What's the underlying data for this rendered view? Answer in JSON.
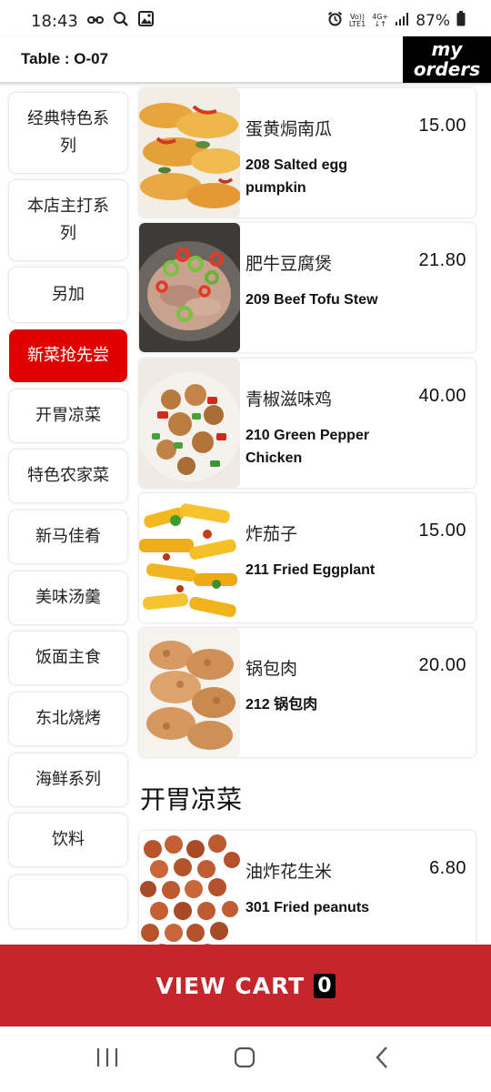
{
  "status": {
    "time": "18:43",
    "battery": "87%",
    "lte_top": "Vo))",
    "lte_bottom": "LTE1",
    "net_top": "4G+",
    "net_bottom": "↓↑"
  },
  "header": {
    "table": "Table : O-07",
    "my_orders_line1": "my",
    "my_orders_line2": "orders"
  },
  "sidebar": {
    "categories": [
      {
        "label": "经典特色系列",
        "active": false
      },
      {
        "label": "本店主打系列",
        "active": false
      },
      {
        "label": "另加",
        "active": false
      },
      {
        "label": "新菜抢先尝",
        "active": true
      },
      {
        "label": "开胃凉菜",
        "active": false
      },
      {
        "label": "特色农家菜",
        "active": false
      },
      {
        "label": "新马佳肴",
        "active": false
      },
      {
        "label": "美味汤羹",
        "active": false
      },
      {
        "label": "饭面主食",
        "active": false
      },
      {
        "label": "东北烧烤",
        "active": false
      },
      {
        "label": "海鲜系列",
        "active": false
      },
      {
        "label": "饮料",
        "active": false
      }
    ]
  },
  "menu": {
    "items": [
      {
        "cn": "蛋黄焗南瓜",
        "en": "208 Salted egg pumpkin",
        "price": "15.00",
        "image": "salted-egg-pumpkin-photo"
      },
      {
        "cn": "肥牛豆腐煲",
        "en": "209 Beef Tofu Stew",
        "price": "21.80",
        "image": "beef-tofu-stew-photo"
      },
      {
        "cn": "青椒滋味鸡",
        "en": "210 Green Pepper Chicken",
        "price": "40.00",
        "image": "green-pepper-chicken-photo"
      },
      {
        "cn": "炸茄子",
        "en": "211 Fried Eggplant",
        "price": "15.00",
        "image": "fried-eggplant-photo"
      },
      {
        "cn": "锅包肉",
        "en": "212 锅包肉",
        "price": "20.00",
        "image": "guo-bao-rou-photo"
      }
    ],
    "section_title": "开胃凉菜",
    "section_items": [
      {
        "cn": "油炸花生米",
        "en": "301 Fried peanuts",
        "price": "6.80",
        "image": "fried-peanuts-photo"
      }
    ]
  },
  "cart": {
    "label": "VIEW CART",
    "count": "0"
  },
  "colors": {
    "accent_red": "#e00000",
    "cart_red": "#c4262b",
    "black": "#000000"
  },
  "navbar": {
    "icons": [
      "recent-apps-icon",
      "home-icon",
      "back-icon"
    ]
  }
}
